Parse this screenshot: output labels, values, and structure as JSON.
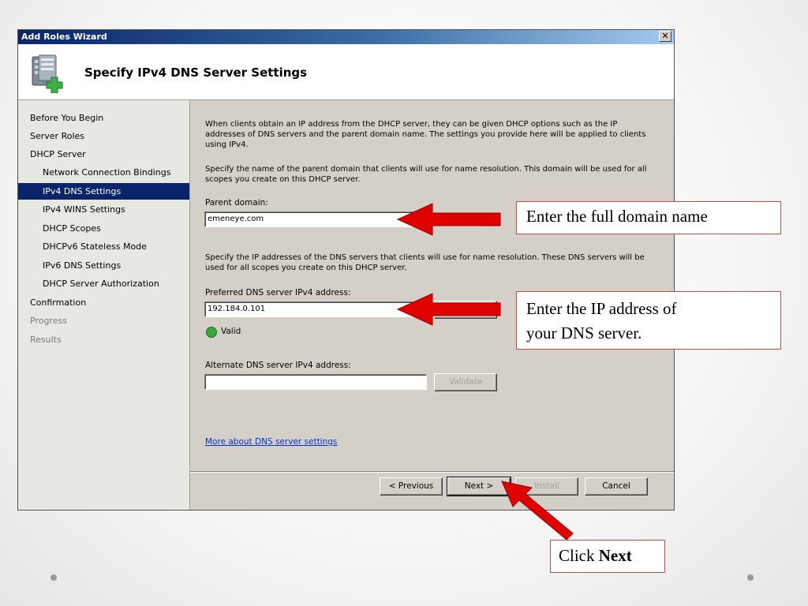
{
  "window": {
    "title": "Add Roles Wizard",
    "close_glyph": "✕",
    "page_heading": "Specify IPv4 DNS Server Settings",
    "header_icon": "server-add-icon"
  },
  "nav": {
    "items": [
      {
        "label": "Before You Begin",
        "level": 0,
        "state": "normal"
      },
      {
        "label": "Server Roles",
        "level": 0,
        "state": "normal"
      },
      {
        "label": "DHCP Server",
        "level": 0,
        "state": "normal"
      },
      {
        "label": "Network Connection Bindings",
        "level": 1,
        "state": "normal"
      },
      {
        "label": "IPv4 DNS Settings",
        "level": 1,
        "state": "selected"
      },
      {
        "label": "IPv4 WINS Settings",
        "level": 1,
        "state": "normal"
      },
      {
        "label": "DHCP Scopes",
        "level": 1,
        "state": "normal"
      },
      {
        "label": "DHCPv6 Stateless Mode",
        "level": 1,
        "state": "normal"
      },
      {
        "label": "IPv6 DNS Settings",
        "level": 1,
        "state": "normal"
      },
      {
        "label": "DHCP Server Authorization",
        "level": 1,
        "state": "normal"
      },
      {
        "label": "Confirmation",
        "level": 0,
        "state": "normal"
      },
      {
        "label": "Progress",
        "level": 0,
        "state": "disabled"
      },
      {
        "label": "Results",
        "level": 0,
        "state": "disabled"
      }
    ]
  },
  "content": {
    "intro": "When clients obtain an IP address from the DHCP server, they can be given DHCP options such as the IP addresses of DNS servers and the parent domain name. The settings you provide here will be applied to clients using IPv4.",
    "domain_instructions": "Specify the name of the parent domain that clients will use for name resolution. This domain will be used for all scopes you create on this DHCP server.",
    "parent_domain_label": "Parent domain:",
    "parent_domain_value": "emeneye.com",
    "dns_instructions": "Specify the IP addresses of the DNS servers that clients will use for name resolution. These DNS servers will be used for all scopes you create on this DHCP server.",
    "preferred_dns_label": "Preferred DNS server IPv4 address:",
    "preferred_dns_value": "192.184.0.101",
    "valid_text": "Valid",
    "alternate_dns_label": "Alternate DNS server IPv4 address:",
    "alternate_dns_value": "",
    "validate_label": "Validate",
    "more_link": "More about DNS server settings"
  },
  "buttons": {
    "previous": "< Previous",
    "next": "Next >",
    "install": "Install",
    "cancel": "Cancel"
  },
  "annotations": {
    "domain_callout": "Enter the full domain name",
    "dns_callout_line1": "Enter the IP address of",
    "dns_callout_line2": "your DNS server.",
    "next_callout_prefix": "Click",
    "next_callout_bold": "Next",
    "arrow_color": "#e00000"
  }
}
